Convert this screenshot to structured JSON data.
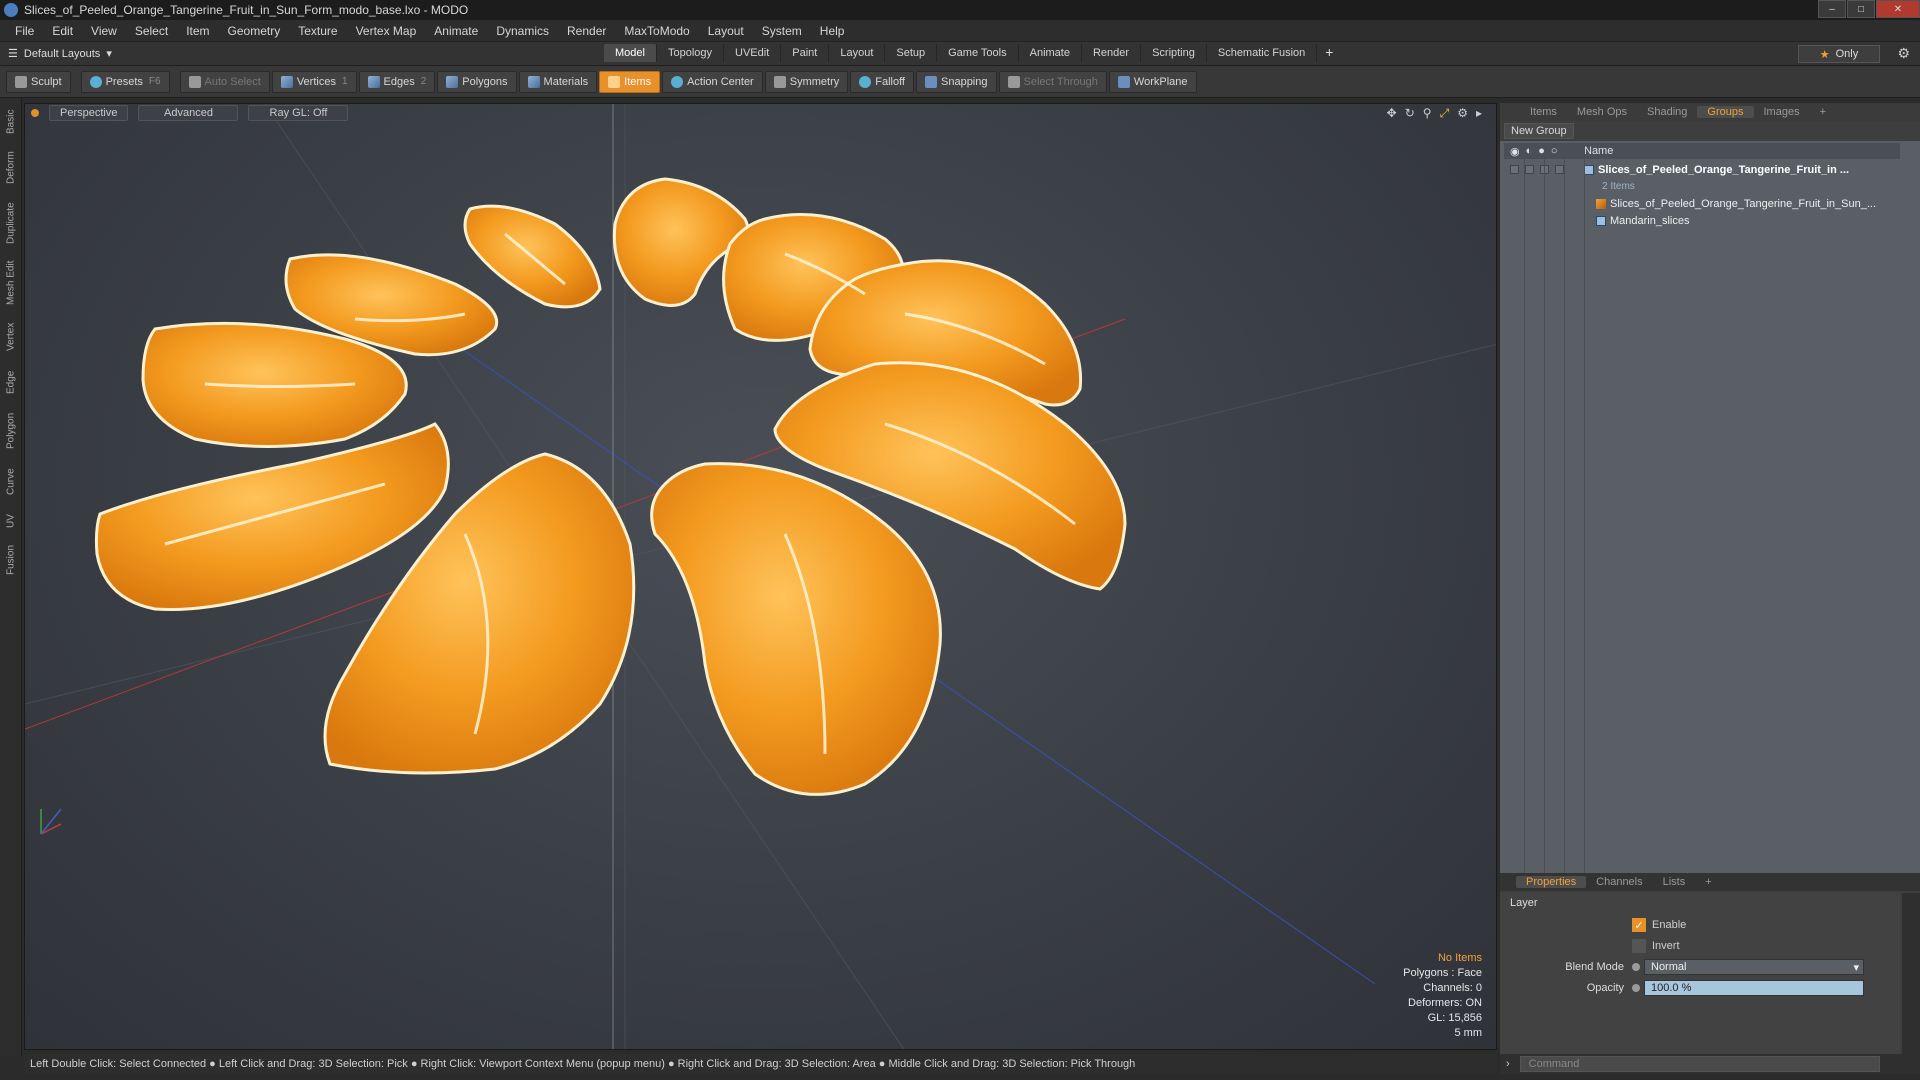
{
  "window": {
    "title": "Slices_of_Peeled_Orange_Tangerine_Fruit_in_Sun_Form_modo_base.lxo - MODO"
  },
  "menu": [
    "File",
    "Edit",
    "View",
    "Select",
    "Item",
    "Geometry",
    "Texture",
    "Vertex Map",
    "Animate",
    "Dynamics",
    "Render",
    "MaxToModo",
    "Layout",
    "System",
    "Help"
  ],
  "layout": {
    "dropdown": "Default Layouts",
    "tabs": [
      "Model",
      "Topology",
      "UVEdit",
      "Paint",
      "Layout",
      "Setup",
      "Game Tools",
      "Animate",
      "Render",
      "Scripting",
      "Schematic Fusion"
    ],
    "active_tab": "Model",
    "only_label": "Only"
  },
  "toolbar": {
    "sculpt": "Sculpt",
    "presets": "Presets",
    "presets_key": "F6",
    "auto_select": "Auto Select",
    "vertices": "Vertices",
    "vertices_key": "1",
    "edges": "Edges",
    "edges_key": "2",
    "polygons": "Polygons",
    "materials": "Materials",
    "items": "Items",
    "action_center": "Action Center",
    "symmetry": "Symmetry",
    "falloff": "Falloff",
    "snapping": "Snapping",
    "select_through": "Select Through",
    "workplane": "WorkPlane"
  },
  "left_tabs": [
    "Basic",
    "Deform",
    "Duplicate",
    "Mesh Edit",
    "Vertex",
    "Edge",
    "Polygon",
    "Curve",
    "UV",
    "Fusion"
  ],
  "viewport": {
    "view": "Perspective",
    "mode": "Advanced",
    "raygl": "Ray GL: Off",
    "info": {
      "selection": "No Items",
      "polygons": "Polygons : Face",
      "channels": "Channels: 0",
      "deformers": "Deformers: ON",
      "gl": "GL: 15,856",
      "scale": "5 mm"
    }
  },
  "status": "Left Double Click: Select Connected ● Left Click and Drag: 3D Selection: Pick ● Right Click: Viewport Context Menu (popup menu) ● Right Click and Drag: 3D Selection: Area ● Middle Click and Drag: 3D Selection: Pick Through",
  "right_panel": {
    "tabs": [
      "Items",
      "Mesh Ops",
      "Shading",
      "Groups",
      "Images"
    ],
    "active_tab": "Groups",
    "new_group": "New Group",
    "col_name": "Name",
    "tree": {
      "group": "Slices_of_Peeled_Orange_Tangerine_Fruit_in ...",
      "count": "2 Items",
      "child1": "Slices_of_Peeled_Orange_Tangerine_Fruit_in_Sun_...",
      "child2": "Mandarin_slices"
    }
  },
  "properties": {
    "tabs": [
      "Properties",
      "Channels",
      "Lists"
    ],
    "active_tab": "Properties",
    "section": "Layer",
    "enable": "Enable",
    "invert": "Invert",
    "blend_label": "Blend Mode",
    "blend_value": "Normal",
    "opacity_label": "Opacity",
    "opacity_value": "100.0 %"
  },
  "command": {
    "placeholder": "Command"
  },
  "colors": {
    "accent": "#e8902a",
    "orange_fruit": "#f29a22",
    "viewport_bg": "#3a3e45"
  }
}
